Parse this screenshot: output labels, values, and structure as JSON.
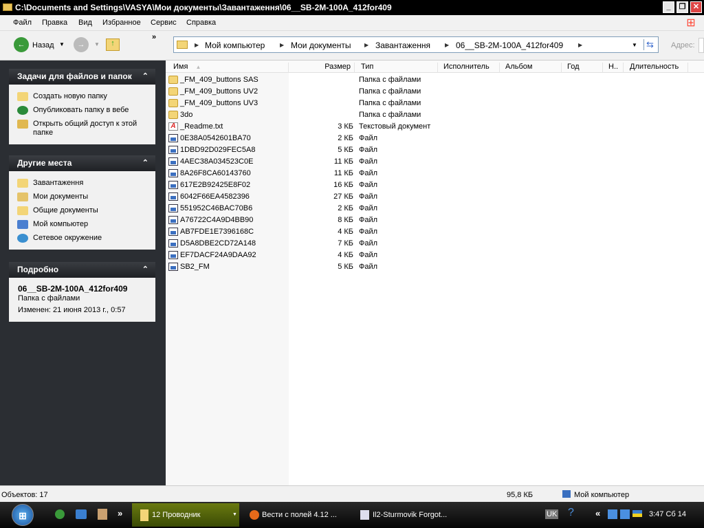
{
  "window": {
    "title": "C:\\Documents and Settings\\VASYA\\Мои документы\\Завантаження\\06__SB-2M-100A_412for409"
  },
  "menu": [
    "Файл",
    "Правка",
    "Вид",
    "Избранное",
    "Сервис",
    "Справка"
  ],
  "toolbar": {
    "back": "Назад",
    "more": "»",
    "address_label": "Адрес:"
  },
  "breadcrumb": [
    "Мой компьютер",
    "Мои документы",
    "Завантаження",
    "06__SB-2M-100A_412for409"
  ],
  "tasks": {
    "title": "Задачи для файлов и папок",
    "items": [
      "Создать новую папку",
      "Опубликовать папку в вебе",
      "Открыть общий доступ к этой папке"
    ]
  },
  "places": {
    "title": "Другие места",
    "items": [
      "Завантаження",
      "Мои документы",
      "Общие документы",
      "Мой компьютер",
      "Сетевое окружение"
    ]
  },
  "details": {
    "title": "Подробно",
    "name": "06__SB-2M-100A_412for409",
    "type": "Папка с файлами",
    "modified": "Изменен: 21 июня 2013 г., 0:57"
  },
  "columns": [
    "Имя",
    "Размер",
    "Тип",
    "Исполнитель",
    "Альбом",
    "Год",
    "Н..",
    "Длительность"
  ],
  "files": [
    {
      "name": "_FM_409_buttons SAS",
      "size": "",
      "type": "Папка с файлами",
      "icon": "folder"
    },
    {
      "name": "_FM_409_buttons UV2",
      "size": "",
      "type": "Папка с файлами",
      "icon": "folder"
    },
    {
      "name": "_FM_409_buttons UV3",
      "size": "",
      "type": "Папка с файлами",
      "icon": "folder"
    },
    {
      "name": "3do",
      "size": "",
      "type": "Папка с файлами",
      "icon": "folder"
    },
    {
      "name": "_Readme.txt",
      "size": "3 КБ",
      "type": "Текстовый документ",
      "icon": "txt"
    },
    {
      "name": "0E38A0542601BA70",
      "size": "2 КБ",
      "type": "Файл",
      "icon": "file"
    },
    {
      "name": "1DBD92D029FEC5A8",
      "size": "5 КБ",
      "type": "Файл",
      "icon": "file"
    },
    {
      "name": "4AEC38A034523C0E",
      "size": "11 КБ",
      "type": "Файл",
      "icon": "file"
    },
    {
      "name": "8A26F8CA60143760",
      "size": "11 КБ",
      "type": "Файл",
      "icon": "file"
    },
    {
      "name": "617E2B92425E8F02",
      "size": "16 КБ",
      "type": "Файл",
      "icon": "file"
    },
    {
      "name": "6042F66EA4582396",
      "size": "27 КБ",
      "type": "Файл",
      "icon": "file"
    },
    {
      "name": "551952C46BAC70B6",
      "size": "2 КБ",
      "type": "Файл",
      "icon": "file"
    },
    {
      "name": "A76722C4A9D4BB90",
      "size": "8 КБ",
      "type": "Файл",
      "icon": "file"
    },
    {
      "name": "AB7FDE1E7396168C",
      "size": "4 КБ",
      "type": "Файл",
      "icon": "file"
    },
    {
      "name": "D5A8DBE2CD72A148",
      "size": "7 КБ",
      "type": "Файл",
      "icon": "file"
    },
    {
      "name": "EF7DACF24A9DAA92",
      "size": "4 КБ",
      "type": "Файл",
      "icon": "file"
    },
    {
      "name": "SB2_FM",
      "size": "5 КБ",
      "type": "Файл",
      "icon": "file"
    }
  ],
  "status": {
    "objects": "Объектов: 17",
    "size": "95,8 КБ",
    "location": "Мой компьютер"
  },
  "taskbar": {
    "explorer": "12 Проводник",
    "firefox": "Вести с полей 4.12 ...",
    "il2": "Il2-Sturmovik Forgot...",
    "lang": "UK",
    "help": "?",
    "clock": "3:47 Сб 14",
    "more": "»",
    "tray_more": "«"
  }
}
